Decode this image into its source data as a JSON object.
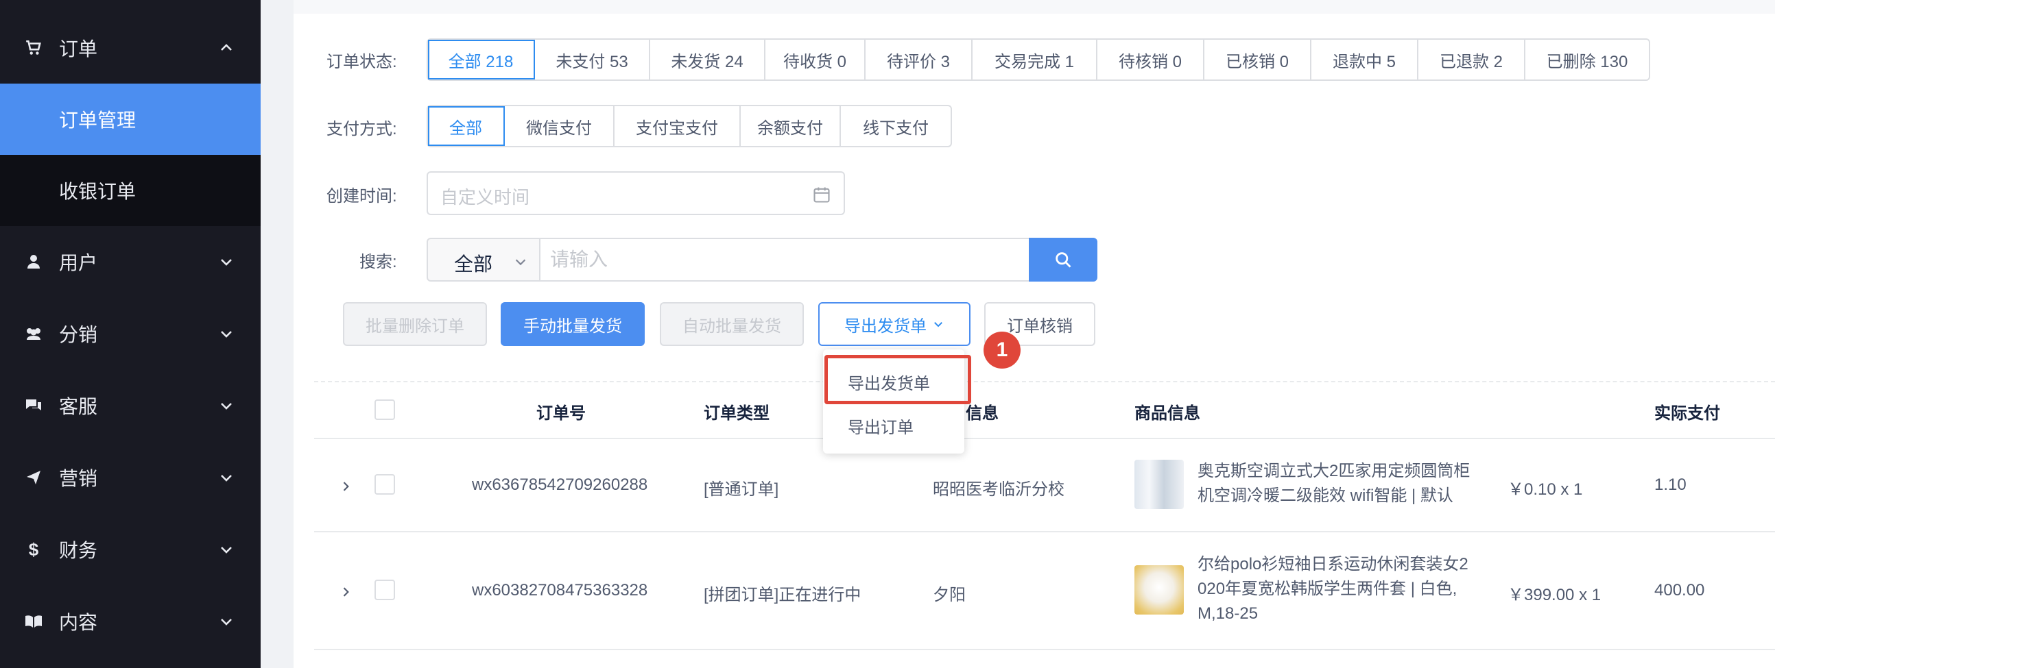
{
  "sidebar": {
    "items": [
      {
        "label": "订单",
        "icon": "cart-icon",
        "expanded": true
      },
      {
        "label": "用户",
        "icon": "user-icon"
      },
      {
        "label": "分销",
        "icon": "group-icon"
      },
      {
        "label": "客服",
        "icon": "chat-icon"
      },
      {
        "label": "营销",
        "icon": "send-icon"
      },
      {
        "label": "财务",
        "icon": "dollar-icon"
      },
      {
        "label": "内容",
        "icon": "book-icon"
      }
    ],
    "sub_items": [
      {
        "label": "订单管理",
        "active": true
      },
      {
        "label": "收银订单",
        "active": false
      }
    ]
  },
  "filters": {
    "status_label": "订单状态:",
    "status_options": [
      "全部 218",
      "未支付 53",
      "未发货 24",
      "待收货 0",
      "待评价 3",
      "交易完成 1",
      "待核销 0",
      "已核销 0",
      "退款中 5",
      "已退款 2",
      "已删除 130"
    ],
    "pay_label": "支付方式:",
    "pay_options": [
      "全部",
      "微信支付",
      "支付宝支付",
      "余额支付",
      "线下支付"
    ],
    "time_label": "创建时间:",
    "time_placeholder": "自定义时间",
    "search_label": "搜索:",
    "search_scope": "全部",
    "search_placeholder": "请输入"
  },
  "actions": {
    "batch_delete": "批量删除订单",
    "manual_ship": "手动批量发货",
    "auto_ship": "自动批量发货",
    "export_ship": "导出发货单",
    "verify": "订单核销"
  },
  "dropdown": {
    "items": [
      "导出发货单",
      "导出订单"
    ],
    "badge": "1"
  },
  "table": {
    "headers": [
      "订单号",
      "订单类型",
      "信息",
      "商品信息",
      "实际支付"
    ],
    "rows": [
      {
        "order_no": "wx63678542709260288",
        "type": "[普通订单]",
        "user": "昭昭医考临沂分校",
        "goods_line1": "奥克斯空调立式大2匹家用定频圆筒柜",
        "goods_line2": "机空调冷暖二级能效 wifi智能 | 默认",
        "qty": "￥0.10 x 1",
        "paid": "1.10"
      },
      {
        "order_no": "wx60382708475363328",
        "type": "[拼团订单]正在进行中",
        "user": "夕阳",
        "goods_line1": "尔给polo衫短袖日系运动休闲套装女2",
        "goods_line2": "020年夏宽松韩版学生两件套 | 白色,",
        "goods_line3": "M,18-25",
        "qty": "￥399.00 x 1",
        "paid": "400.00"
      }
    ]
  },
  "colors": {
    "sidebar_bg": "#191a23",
    "active_blue": "#4c8ef0",
    "highlight_red": "#e0463a"
  }
}
